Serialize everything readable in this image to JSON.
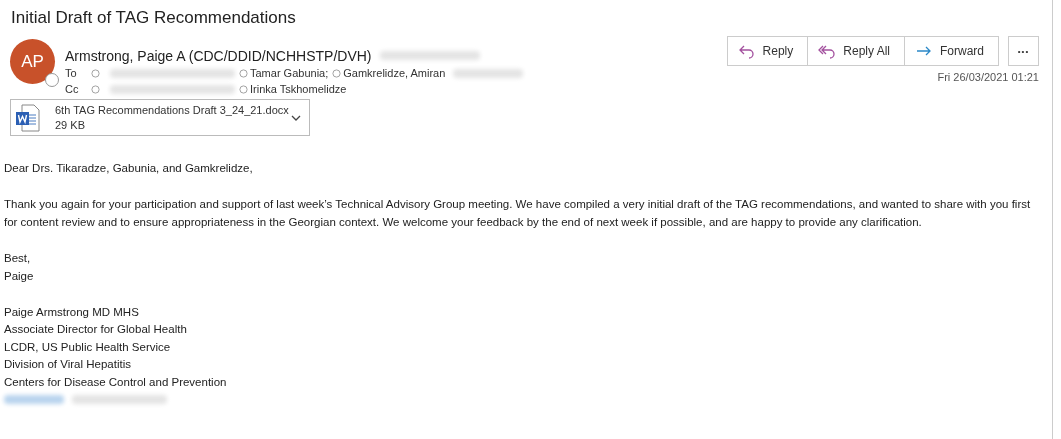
{
  "subject": "Initial Draft of TAG Recommendations",
  "sender": {
    "initials": "AP",
    "name": "Armstrong, Paige A (CDC/DDID/NCHHSTP/DVH)"
  },
  "recipients": [
    {
      "label": "To",
      "names": [
        "Tamar Gabunia;",
        "Gamkrelidze, Amiran"
      ]
    },
    {
      "label": "Cc",
      "names": [
        "Irinka Tskhomelidze"
      ]
    }
  ],
  "actions": [
    {
      "kind": "reply",
      "label": "Reply"
    },
    {
      "kind": "reply-all",
      "label": "Reply All"
    },
    {
      "kind": "forward",
      "label": "Forward"
    }
  ],
  "more": "•••",
  "date": "Fri 26/03/2021 01:21",
  "attachment": {
    "name": "6th TAG Recommendations Draft 3_24_21.docx",
    "size": "29 KB"
  },
  "body": [
    [
      "Dear Drs. Tikaradze, Gabunia, and Gamkrelidze,"
    ],
    [
      "Thank you again for your participation and support of last week’s Technical Advisory Group meeting. We have compiled a very initial draft of the TAG recommendations, and wanted to share with you first for content review and to ensure appropriateness in the Georgian context. We welcome your feedback by the end of next week if possible, and are happy to provide any clarification."
    ],
    [
      "Best,",
      "Paige"
    ],
    [
      "Paige Armstrong MD MHS",
      "Associate Director for Global Health",
      "LCDR, US Public Health Service",
      "Division of Viral Hepatitis",
      "Centers for Disease Control and Prevention"
    ]
  ]
}
